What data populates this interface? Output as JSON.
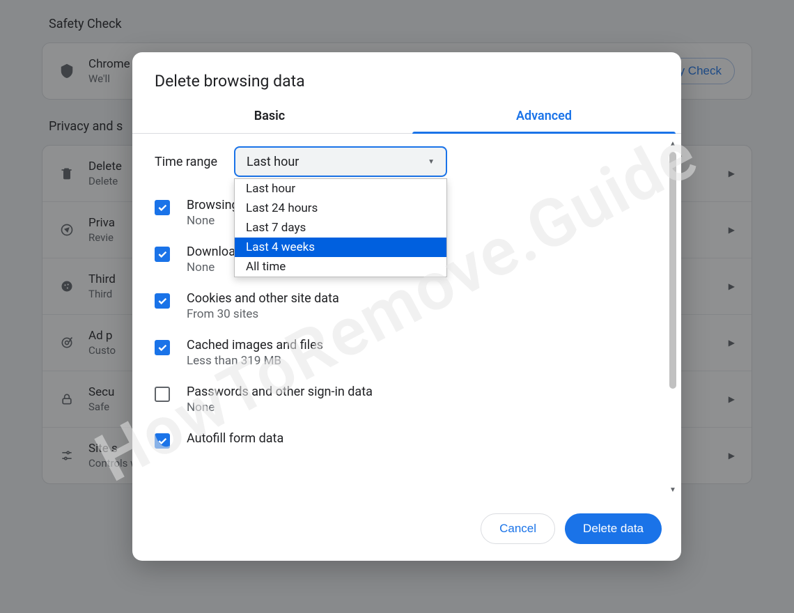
{
  "watermark": "HowToRemove.Guide",
  "bg": {
    "section1_title": "Safety Check",
    "safety_row_title": "Chrome",
    "safety_row_sub": "We'll",
    "safety_button": "ty Check",
    "section2_title": "Privacy and s",
    "rows": [
      {
        "icon": "trash-icon",
        "title": "Delete",
        "sub": "Delete"
      },
      {
        "icon": "compass-icon",
        "title": "Priva",
        "sub": "Revie"
      },
      {
        "icon": "cookie-icon",
        "title": "Third",
        "sub": "Third"
      },
      {
        "icon": "target-icon",
        "title": "Ad p",
        "sub": "Custo"
      },
      {
        "icon": "lock-icon",
        "title": "Secu",
        "sub": "Safe"
      },
      {
        "icon": "sliders-icon",
        "title": "Site s",
        "sub": "Controls what information sites can use and show (location, camera, pop-ups, and more)"
      }
    ]
  },
  "dialog": {
    "title": "Delete browsing data",
    "tabs": {
      "basic": "Basic",
      "advanced": "Advanced",
      "active": "advanced"
    },
    "time_range_label": "Time range",
    "time_range_value": "Last hour",
    "time_range_options": [
      "Last hour",
      "Last 24 hours",
      "Last 7 days",
      "Last 4 weeks",
      "All time"
    ],
    "time_range_highlighted": "Last 4 weeks",
    "data_types": [
      {
        "checked": true,
        "title": "Browsing history",
        "sub": "None"
      },
      {
        "checked": true,
        "title": "Download history",
        "sub": "None"
      },
      {
        "checked": true,
        "title": "Cookies and other site data",
        "sub": "From 30 sites"
      },
      {
        "checked": true,
        "title": "Cached images and files",
        "sub": "Less than 319 MB"
      },
      {
        "checked": false,
        "title": "Passwords and other sign-in data",
        "sub": "None"
      },
      {
        "checked": true,
        "title": "Autofill form data",
        "sub": ""
      }
    ],
    "cancel": "Cancel",
    "delete": "Delete data"
  }
}
